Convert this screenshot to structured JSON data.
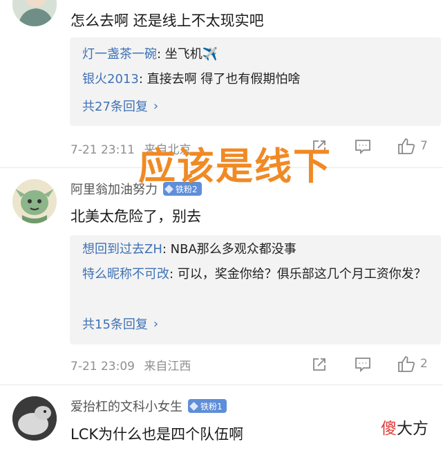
{
  "comments": [
    {
      "text": "怎么去啊 还是线上不太现实吧",
      "replies": [
        {
          "name": "灯一盏茶一碗",
          "sep": ": ",
          "text": "坐飞机✈️"
        },
        {
          "name": "银火2013",
          "sep": ": ",
          "text": "直接去啊 得了也有假期怕啥"
        }
      ],
      "more": "共27条回复",
      "time": "7-21 23:11",
      "location": "来自北京",
      "likes": "7"
    },
    {
      "username": "阿里翁加油努力",
      "badge": "铁粉2",
      "text": "北美太危险了，别去",
      "replies": [
        {
          "name": "想回到过去ZH",
          "sep": ": ",
          "text": "NBA那么多观众都没事"
        },
        {
          "name": "特么昵称不可改",
          "sep": ": ",
          "text": "可以，奖金你给？俱乐部这几个月工资你发？"
        }
      ],
      "more": "共15条回复",
      "time": "7-21 23:09",
      "location": "来自江西",
      "likes": "2"
    },
    {
      "username": "爱抬杠的文科小女生",
      "badge": "铁粉1",
      "text": "LCK为什么也是四个队伍啊"
    }
  ],
  "overlay_text": "应该是线下",
  "watermark": {
    "first": "傻",
    "rest": "大方"
  },
  "icons": {
    "share": "share-icon",
    "comment": "comment-icon",
    "like": "thumbs-up-icon",
    "chevron": "chevron-right-icon"
  },
  "colors": {
    "link": "#3e72b4",
    "badge": "#5f8ed8",
    "overlay": "#f08a25"
  }
}
